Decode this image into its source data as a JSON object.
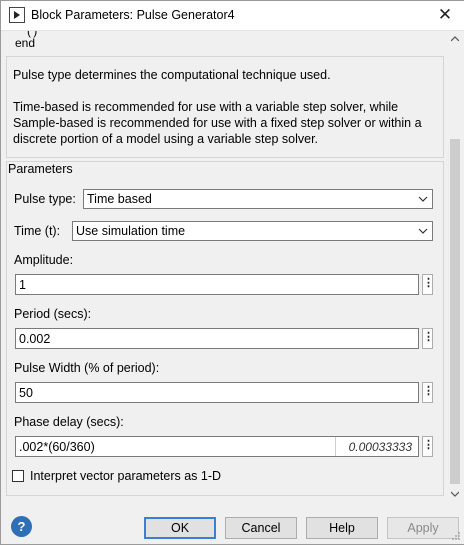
{
  "window": {
    "title": "Block Parameters: Pulse Generator4",
    "close_glyph": "✕"
  },
  "code": {
    "cut_text": "(')",
    "end_text": "end"
  },
  "description": {
    "line1": "Pulse type determines the computational technique used.",
    "line2": "Time-based is recommended for use with a variable step solver, while Sample-based is recommended for use with a fixed step solver or within a discrete portion of a model using a variable step solver."
  },
  "parameters": {
    "group_label": "Parameters",
    "pulse_type": {
      "label": "Pulse type:",
      "value": "Time based"
    },
    "time": {
      "label": "Time (t):",
      "value": "Use simulation time"
    },
    "amplitude": {
      "label": "Amplitude:",
      "value": "1"
    },
    "period": {
      "label": "Period (secs):",
      "value": "0.002"
    },
    "pulse_width": {
      "label": "Pulse Width (% of period):",
      "value": "50"
    },
    "phase_delay": {
      "label": "Phase delay (secs):",
      "value": ".002*(60/360)",
      "evaluated": "0.00033333"
    },
    "interpret_vector": {
      "label": "Interpret vector parameters as 1-D",
      "checked": false
    },
    "dots_glyph": "⋮"
  },
  "buttons": {
    "help_glyph": "?",
    "ok": "OK",
    "cancel": "Cancel",
    "help": "Help",
    "apply": "Apply"
  },
  "colors": {
    "accent": "#3c7fd1",
    "help_icon": "#2e6fb5"
  }
}
